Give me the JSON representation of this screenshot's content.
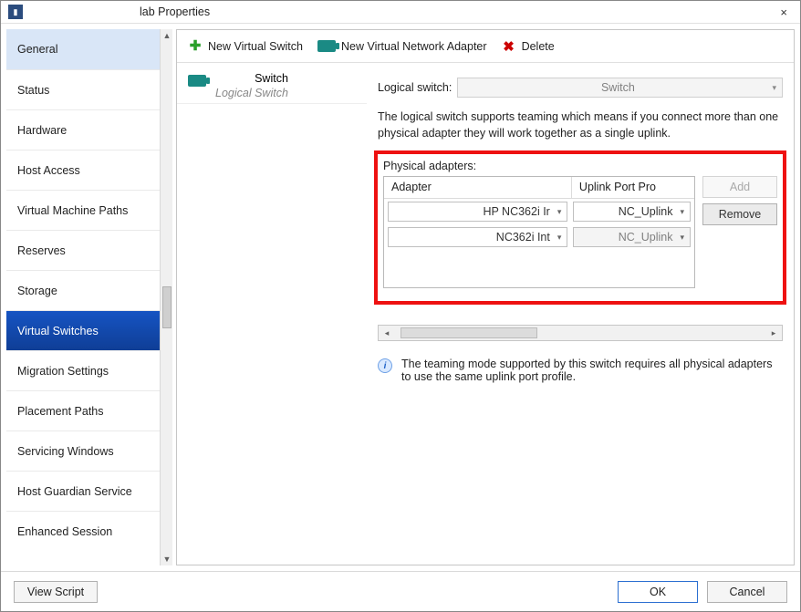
{
  "window": {
    "title": "lab Properties",
    "close_label": "×"
  },
  "sidebar": {
    "items": [
      {
        "label": "General"
      },
      {
        "label": "Status"
      },
      {
        "label": "Hardware"
      },
      {
        "label": "Host Access"
      },
      {
        "label": "Virtual Machine Paths"
      },
      {
        "label": "Reserves"
      },
      {
        "label": "Storage"
      },
      {
        "label": "Virtual Switches"
      },
      {
        "label": "Migration Settings"
      },
      {
        "label": "Placement Paths"
      },
      {
        "label": "Servicing Windows"
      },
      {
        "label": "Host Guardian Service"
      },
      {
        "label": "Enhanced Session"
      }
    ],
    "selected_index": 7,
    "hover_index": 0
  },
  "toolbar": {
    "new_switch_label": "New Virtual Switch",
    "new_adapter_label": "New Virtual Network Adapter",
    "delete_label": "Delete"
  },
  "switch_list": {
    "items": [
      {
        "title": "Switch",
        "subtitle": "Logical Switch"
      }
    ]
  },
  "detail": {
    "logical_switch_label": "Logical switch:",
    "logical_switch_value": "Switch",
    "description": "The logical switch supports teaming which means if you connect more than one physical adapter they will work together as a single uplink.",
    "physical_adapters_label": "Physical adapters:",
    "columns": {
      "adapter": "Adapter",
      "uplink": "Uplink Port Pro"
    },
    "rows": [
      {
        "adapter": "HP NC362i Ir",
        "uplink": "NC_Uplink",
        "uplink_editable": true
      },
      {
        "adapter": "NC362i Int",
        "uplink": "NC_Uplink",
        "uplink_editable": false
      }
    ],
    "add_label": "Add",
    "remove_label": "Remove",
    "info_text": "The teaming mode supported by this switch requires all physical adapters to use the same uplink port profile."
  },
  "footer": {
    "view_script_label": "View Script",
    "ok_label": "OK",
    "cancel_label": "Cancel"
  }
}
